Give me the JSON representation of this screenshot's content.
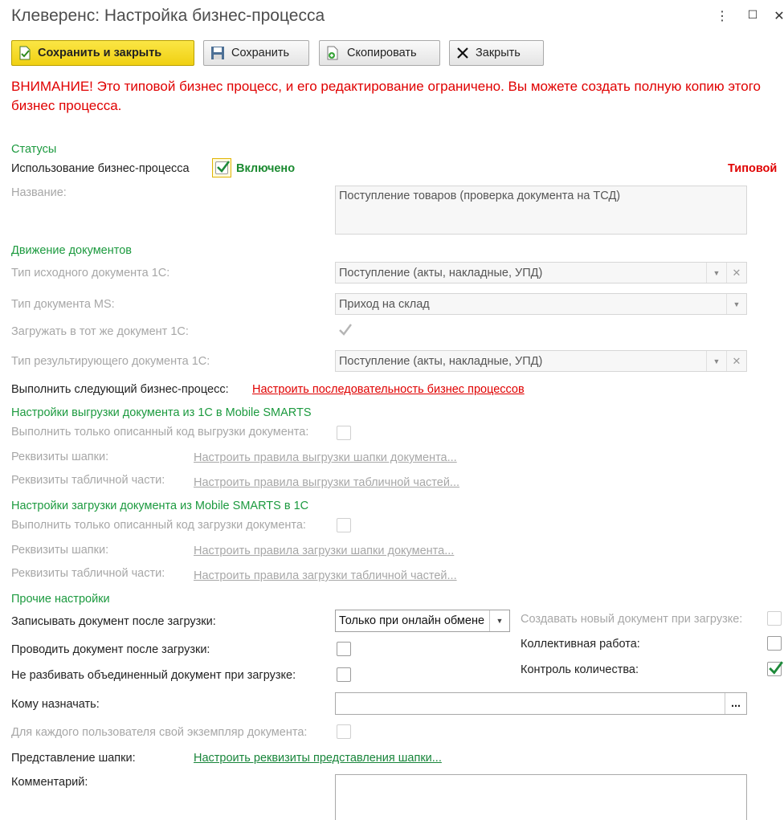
{
  "window": {
    "title": "Клеверенс: Настройка бизнес-процесса"
  },
  "toolbar": {
    "save_close": "Сохранить и закрыть",
    "save": "Сохранить",
    "copy": "Скопировать",
    "close": "Закрыть"
  },
  "warning": "ВНИМАНИЕ! Это типовой бизнес процесс, и его редактирование ограничено. Вы можете создать полную копию этого бизнес процесса.",
  "statuses": {
    "section": "Статусы",
    "usage_label": "Использование бизнес-процесса",
    "enabled_label": "Включено",
    "enabled": true,
    "typical": "Типовой",
    "name_label": "Название:",
    "name_value": "Поступление товаров (проверка документа на ТСД)"
  },
  "movement": {
    "section": "Движение документов",
    "source_type_label": "Тип исходного документа 1С:",
    "source_type_value": "Поступление (акты, накладные, УПД)",
    "ms_type_label": "Тип документа MS:",
    "ms_type_value": "Приход на склад",
    "same_doc_label": "Загружать в тот же документ 1С:",
    "same_doc": true,
    "result_type_label": "Тип результирующего документа 1С:",
    "result_type_value": "Поступление (акты, накладные, УПД)"
  },
  "next_process": {
    "label": "Выполнить следующий бизнес-процесс:",
    "link": "Настроить последовательность бизнес процессов"
  },
  "export": {
    "section": "Настройки выгрузки документа из 1С в Mobile SMARTS",
    "only_code_label": "Выполнить только описанный код выгрузки документа:",
    "header_label": "Реквизиты шапки:",
    "header_link": "Настроить правила выгрузки шапки документа...",
    "table_label": "Реквизиты табличной части:",
    "table_link": "Настроить правила выгрузки табличной частей..."
  },
  "import": {
    "section": "Настройки загрузки документа из Mobile SMARTS в 1С",
    "only_code_label": "Выполнить только описанный код загрузки документа:",
    "header_label": "Реквизиты шапки:",
    "header_link": "Настроить правила загрузки шапки документа...",
    "table_label": "Реквизиты табличной части:",
    "table_link": "Настроить правила загрузки табличной частей..."
  },
  "other": {
    "section": "Прочие настройки",
    "write_label": "Записывать документ после загрузки:",
    "write_value": "Только при онлайн обмене",
    "post_label": "Проводить документ после загрузки:",
    "no_split_label": "Не разбивать объединенный документ при загрузке:",
    "create_new_label": "Создавать новый документ при загрузке:",
    "collective_label": "Коллективная работа:",
    "qty_control_label": "Контроль количества:",
    "qty_control": true,
    "assign_label": "Кому назначать:",
    "assign_value": "",
    "assign_button": "...",
    "per_user_label": "Для каждого пользователя свой экземпляр документа:",
    "header_view_label": "Представление шапки:",
    "header_view_link": "Настроить реквизиты представления шапки...",
    "comment_label": "Комментарий:",
    "comment_value": ""
  }
}
